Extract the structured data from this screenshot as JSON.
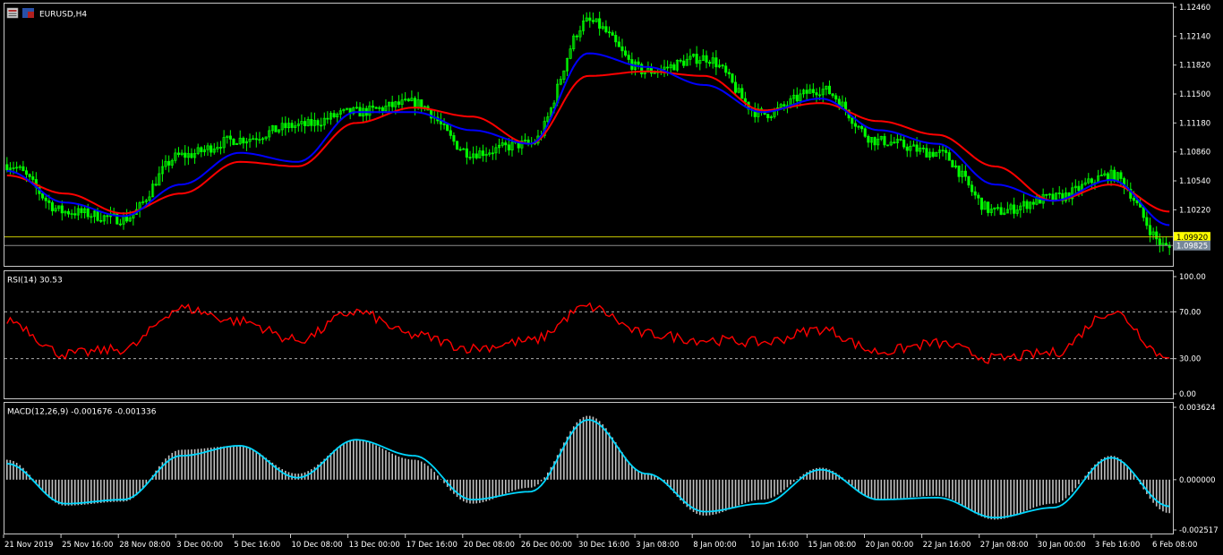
{
  "window": {
    "symbol_title": "EURUSD,H4"
  },
  "price_panel": {
    "y_ticks": [
      "1.12460",
      "1.12140",
      "1.11820",
      "1.11500",
      "1.11180",
      "1.10860",
      "1.10540",
      "1.10220"
    ],
    "price_tags": [
      {
        "label": "1.09920",
        "value": 1.0992,
        "fill": "#ffff00",
        "text_color": "#000000"
      },
      {
        "label": "1.09825",
        "value": 1.09825,
        "fill": "#778899",
        "text_color": "#ffffff"
      }
    ],
    "candle_color": "#00ff00",
    "ma_fast_color": "#0000ff",
    "ma_slow_color": "#ff0000"
  },
  "rsi_panel": {
    "label": "RSI(14) 30.53",
    "y_ticks": [
      "100.00",
      "70.00",
      "30.00",
      "0.00"
    ],
    "levels": [
      70,
      30
    ],
    "line_color": "#ff0000"
  },
  "macd_panel": {
    "label": "MACD(12,26,9) -0.001676 -0.001336",
    "y_ticks": [
      "0.003624",
      "0.000000",
      "-0.002517"
    ],
    "hist_color": "#c0c0c0",
    "signal_color": "#00d7ff"
  },
  "x_axis": {
    "labels": [
      "21 Nov 2019",
      "25 Nov 16:00",
      "28 Nov 08:00",
      "3 Dec 00:00",
      "5 Dec 16:00",
      "10 Dec 08:00",
      "13 Dec 00:00",
      "17 Dec 16:00",
      "20 Dec 08:00",
      "26 Dec 00:00",
      "30 Dec 16:00",
      "3 Jan 08:00",
      "8 Jan 00:00",
      "10 Jan 16:00",
      "15 Jan 08:00",
      "20 Jan 00:00",
      "22 Jan 16:00",
      "27 Jan 08:00",
      "30 Jan 00:00",
      "3 Feb 16:00",
      "6 Feb 08:00"
    ]
  },
  "chart_data": [
    {
      "type": "line",
      "subtype": "candlestick",
      "title": "EURUSD,H4",
      "ylim": [
        1.096,
        1.125
      ],
      "x": [
        "21 Nov 2019",
        "25 Nov 16:00",
        "28 Nov 08:00",
        "3 Dec 00:00",
        "5 Dec 16:00",
        "10 Dec 08:00",
        "13 Dec 00:00",
        "17 Dec 16:00",
        "20 Dec 08:00",
        "26 Dec 00:00",
        "30 Dec 16:00",
        "3 Jan 08:00",
        "8 Jan 00:00",
        "10 Jan 16:00",
        "15 Jan 08:00",
        "20 Jan 00:00",
        "22 Jan 16:00",
        "27 Jan 08:00",
        "30 Jan 00:00",
        "3 Feb 16:00",
        "6 Feb 08:00"
      ],
      "series": [
        {
          "values": [
            1.1072,
            1.102,
            1.1012,
            1.1082,
            1.11,
            1.1115,
            1.113,
            1.114,
            1.1085,
            1.1095,
            1.123,
            1.1175,
            1.119,
            1.1128,
            1.1155,
            1.1098,
            1.1085,
            1.102,
            1.1035,
            1.106,
            1.098
          ]
        },
        {
          "values": [
            1.1065,
            1.103,
            1.1015,
            1.105,
            1.1085,
            1.1075,
            1.113,
            1.113,
            1.111,
            1.1095,
            1.1195,
            1.118,
            1.116,
            1.113,
            1.1145,
            1.111,
            1.1095,
            1.105,
            1.1032,
            1.1055,
            1.1005
          ]
        },
        {
          "values": [
            1.106,
            1.104,
            1.1018,
            1.104,
            1.1075,
            1.107,
            1.1118,
            1.1135,
            1.1125,
            1.1095,
            1.117,
            1.1175,
            1.117,
            1.1132,
            1.114,
            1.112,
            1.1105,
            1.107,
            1.1032,
            1.105,
            1.102
          ]
        }
      ],
      "extra_points": {
        "high_near_30_Dec": 1.1246,
        "low_near_6_Feb": 1.0965
      }
    },
    {
      "type": "line",
      "title": "RSI(14) 30.53",
      "ylim": [
        0,
        100
      ],
      "x": [
        "21 Nov 2019",
        "25 Nov 16:00",
        "28 Nov 08:00",
        "3 Dec 00:00",
        "5 Dec 16:00",
        "10 Dec 08:00",
        "13 Dec 00:00",
        "17 Dec 16:00",
        "20 Dec 08:00",
        "26 Dec 00:00",
        "30 Dec 16:00",
        "3 Jan 08:00",
        "8 Jan 00:00",
        "10 Jan 16:00",
        "15 Jan 08:00",
        "20 Jan 00:00",
        "22 Jan 16:00",
        "27 Jan 08:00",
        "30 Jan 00:00",
        "3 Feb 16:00",
        "6 Feb 08:00"
      ],
      "series": [
        {
          "values": [
            63,
            34,
            38,
            73,
            62,
            46,
            70,
            50,
            39,
            45,
            74,
            51,
            46,
            44,
            55,
            36,
            43,
            30,
            35,
            70,
            30.53
          ]
        }
      ]
    },
    {
      "type": "bar",
      "title": "MACD(12,26,9) -0.001676 -0.001336",
      "ylim": [
        -0.002517,
        0.003624
      ],
      "x": [
        "21 Nov 2019",
        "25 Nov 16:00",
        "28 Nov 08:00",
        "3 Dec 00:00",
        "5 Dec 16:00",
        "10 Dec 08:00",
        "13 Dec 00:00",
        "17 Dec 16:00",
        "20 Dec 08:00",
        "26 Dec 00:00",
        "30 Dec 16:00",
        "3 Jan 08:00",
        "8 Jan 00:00",
        "10 Jan 16:00",
        "15 Jan 08:00",
        "20 Jan 00:00",
        "22 Jan 16:00",
        "27 Jan 08:00",
        "30 Jan 00:00",
        "3 Feb 16:00",
        "6 Feb 08:00"
      ],
      "series": [
        {
          "values": [
            0.001,
            -0.0013,
            -0.0011,
            0.0015,
            0.0017,
            0.0003,
            0.002,
            0.001,
            -0.0012,
            -0.0004,
            0.0032,
            0.0003,
            -0.0018,
            -0.001,
            0.0006,
            -0.001,
            -0.0008,
            -0.002,
            -0.0012,
            0.0012,
            -0.001676
          ]
        },
        {
          "values": [
            0.0008,
            -0.0012,
            -0.001,
            0.0012,
            0.0017,
            0.0001,
            0.002,
            0.0012,
            -0.001,
            -0.0006,
            0.003,
            0.0003,
            -0.0016,
            -0.0012,
            0.0005,
            -0.001,
            -0.0009,
            -0.0019,
            -0.0014,
            0.0011,
            -0.001336
          ]
        }
      ]
    }
  ]
}
